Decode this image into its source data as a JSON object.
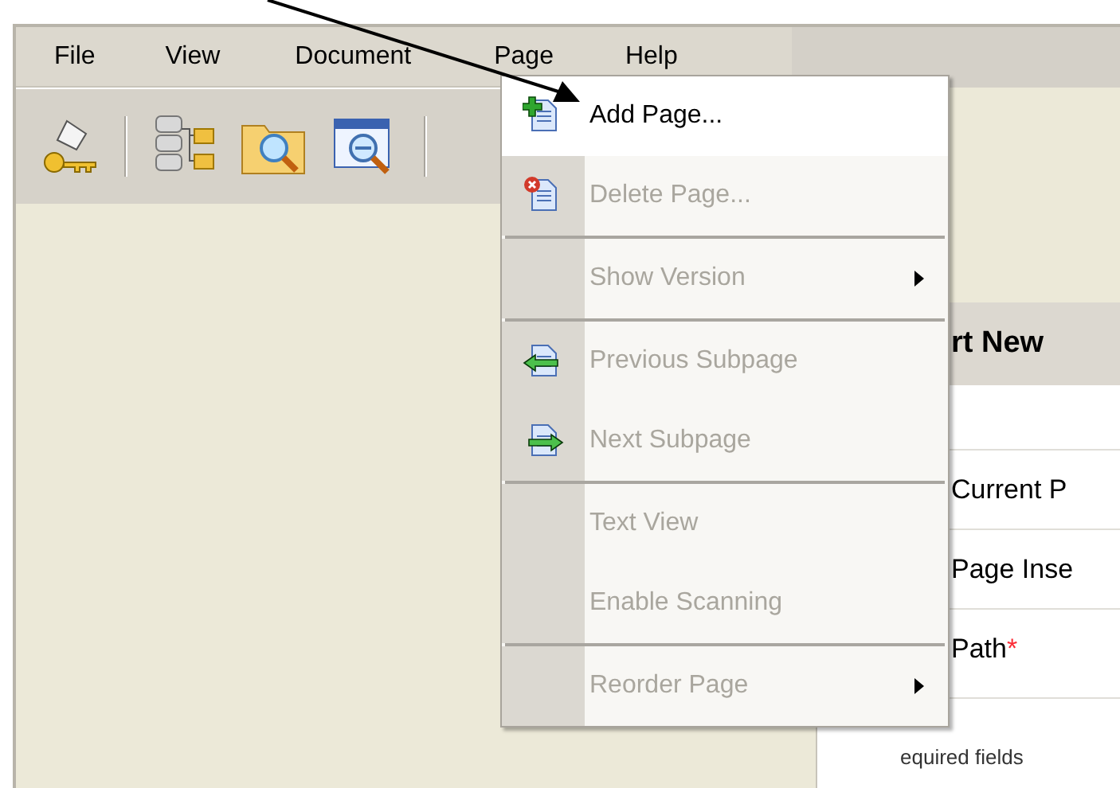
{
  "menu_bar": [
    {
      "label": "File"
    },
    {
      "label": "View"
    },
    {
      "label": "Document"
    },
    {
      "label": "Page"
    },
    {
      "label": "Help"
    }
  ],
  "page_menu": [
    {
      "kind": "item",
      "label": "Add Page...",
      "disabled": false,
      "selected": true,
      "submenu": false
    },
    {
      "kind": "item",
      "label": "Delete Page...",
      "disabled": true,
      "selected": false,
      "submenu": false
    },
    {
      "kind": "separator"
    },
    {
      "kind": "item",
      "label": "Show Version",
      "disabled": true,
      "selected": false,
      "submenu": true
    },
    {
      "kind": "separator"
    },
    {
      "kind": "item",
      "label": "Previous Subpage",
      "disabled": true,
      "selected": false,
      "submenu": false
    },
    {
      "kind": "item",
      "label": "Next Subpage",
      "disabled": true,
      "selected": false,
      "submenu": false
    },
    {
      "kind": "separator"
    },
    {
      "kind": "item",
      "label": "Text View",
      "disabled": true,
      "selected": false,
      "submenu": false
    },
    {
      "kind": "item",
      "label": "Enable Scanning",
      "disabled": true,
      "selected": false,
      "submenu": false
    },
    {
      "kind": "separator"
    },
    {
      "kind": "item",
      "label": "Reorder Page",
      "disabled": true,
      "selected": false,
      "submenu": true
    }
  ],
  "form": {
    "title": "rt New",
    "fields": [
      {
        "label": "Current P"
      },
      {
        "label": "Page Inse"
      },
      {
        "label": "Path",
        "required_mark": "*"
      }
    ],
    "footnote": "equired fields"
  }
}
